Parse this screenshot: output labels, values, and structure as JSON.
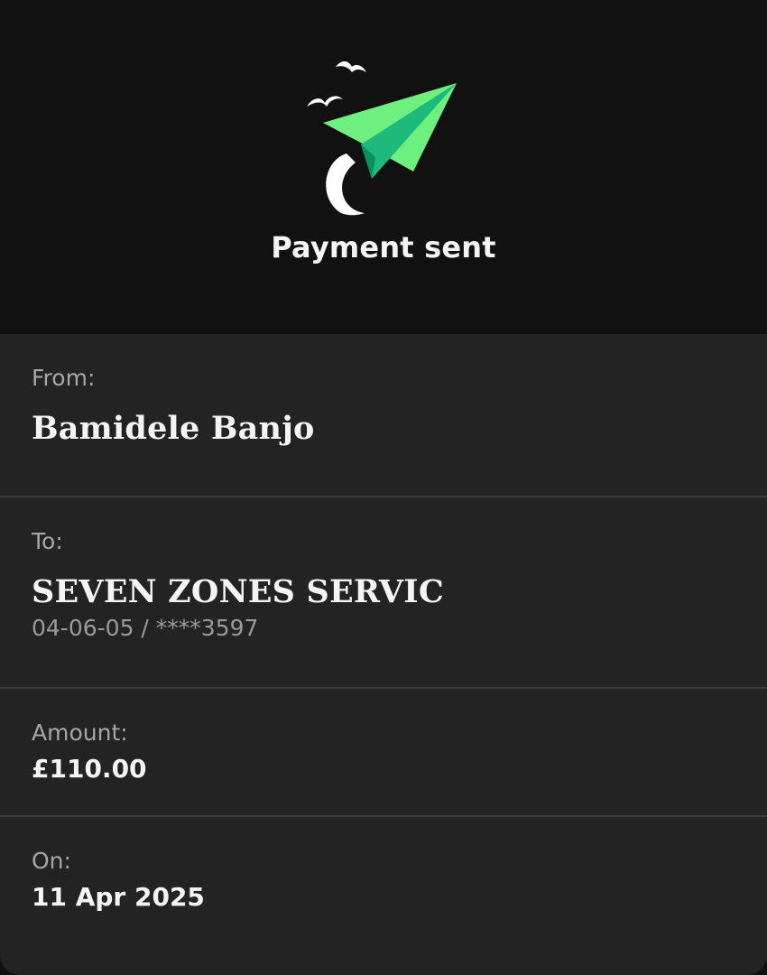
{
  "header": {
    "title": "Payment sent",
    "illustration_icon": "paper-plane-icon",
    "accent_color": "#6ef07f"
  },
  "details": {
    "from": {
      "label": "From:",
      "name": "Bamidele Banjo"
    },
    "to": {
      "label": "To:",
      "name": "SEVEN ZONES SERVIC",
      "account": "04-06-05 / ****3597"
    },
    "amount": {
      "label": "Amount:",
      "value": "£110.00"
    },
    "on": {
      "label": "On:",
      "date": "11 Apr 2025"
    }
  }
}
